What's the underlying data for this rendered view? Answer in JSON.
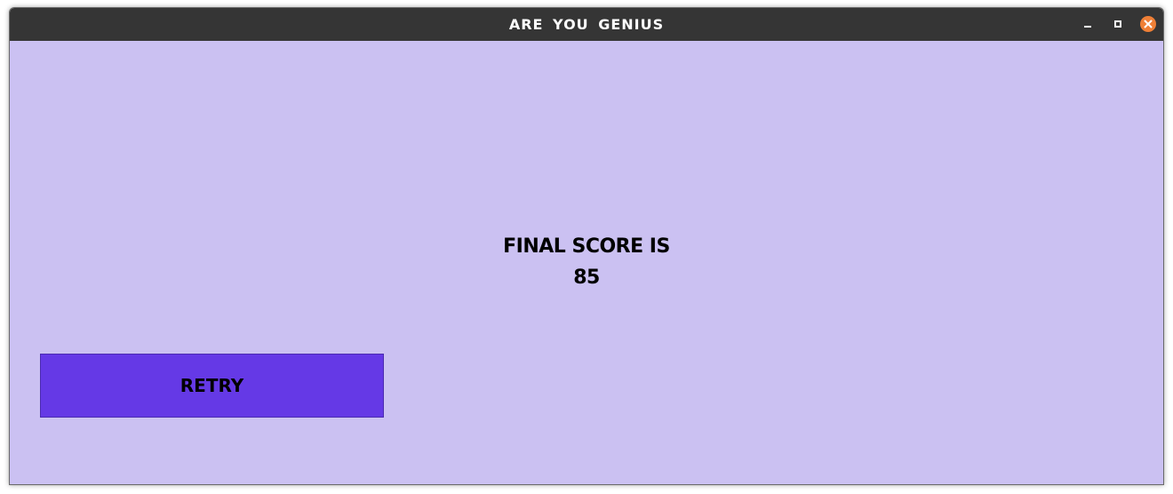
{
  "window": {
    "title": "ARE YOU GENIUS",
    "controls": {
      "minimize": "minimize-icon",
      "maximize": "maximize-icon",
      "close": "close-icon"
    }
  },
  "colors": {
    "titlebar": "#353535",
    "background": "#cbc1f2",
    "button": "#6539e6",
    "close_button": "#ef7f36"
  },
  "result": {
    "label": "FINAL SCORE IS",
    "score": "85"
  },
  "actions": {
    "retry_label": "RETRY"
  }
}
